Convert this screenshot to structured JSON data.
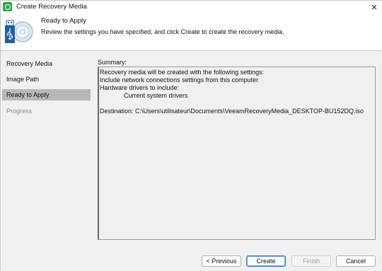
{
  "window": {
    "title": "Create Recovery Media",
    "close_glyph": "✕"
  },
  "header": {
    "title": "Ready to Apply",
    "description": "Review the settings you have specified, and click Create to create the recovery media.",
    "icon": "usb-disc-icon"
  },
  "sidebar": {
    "items": [
      {
        "label": "Recovery Media",
        "state": "normal"
      },
      {
        "label": "Image Path",
        "state": "normal"
      },
      {
        "label": "Ready to Apply",
        "state": "active"
      },
      {
        "label": "Progress",
        "state": "disabled"
      }
    ]
  },
  "summary": {
    "label": "Summary:",
    "lines": [
      "Recovery media will be created with the following settings:",
      "Include network connections settings from this computer",
      "Hardware drivers to include:",
      "Current system drivers",
      "",
      "Destination: C:\\Users\\utilisateur\\Documents\\VeeamRecoveryMedia_DESKTOP-BU152DQ.iso"
    ]
  },
  "footer": {
    "previous_label": "< Previous",
    "create_label": "Create",
    "finish_label": "Finish",
    "cancel_label": "Cancel"
  },
  "colors": {
    "accent": "#2fa84f",
    "active_item": "#b8b8b8",
    "primary_border": "#3a78c8"
  }
}
